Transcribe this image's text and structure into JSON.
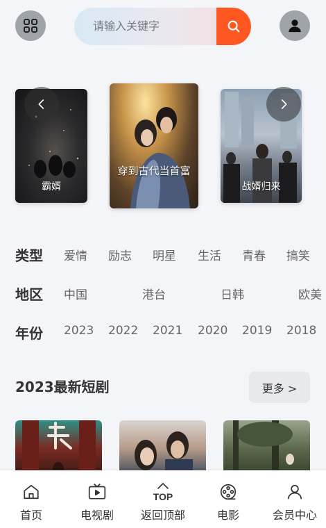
{
  "header": {
    "search_placeholder": "请输入关键字"
  },
  "carousel": {
    "posters": [
      {
        "title": "霸婿"
      },
      {
        "title": "穿到古代当首富"
      },
      {
        "title": "战婿归来"
      }
    ]
  },
  "filters": {
    "type": {
      "label": "类型",
      "items": [
        "爱情",
        "励志",
        "明星",
        "生活",
        "青春",
        "搞笑"
      ]
    },
    "region": {
      "label": "地区",
      "items": [
        "中国",
        "港台",
        "日韩",
        "欧美"
      ]
    },
    "year": {
      "label": "年份",
      "items": [
        "2023",
        "2022",
        "2021",
        "2020",
        "2019",
        "2018"
      ]
    }
  },
  "section": {
    "title": "2023最新短剧",
    "more_label": "更多 >"
  },
  "bottom_nav": {
    "items": [
      {
        "label": "首页",
        "icon": "home-icon"
      },
      {
        "label": "电视剧",
        "icon": "tv-icon"
      },
      {
        "label": "返回顶部",
        "icon": "top-icon"
      },
      {
        "label": "电影",
        "icon": "film-reel-icon"
      },
      {
        "label": "会员中心",
        "icon": "user-icon"
      }
    ]
  },
  "colors": {
    "accent": "#ff5722",
    "page_bg": "#f4f5f8",
    "icon_circle": "#9fa3aa"
  }
}
